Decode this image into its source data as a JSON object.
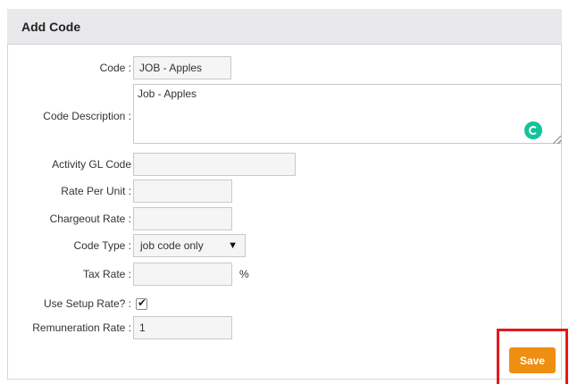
{
  "header": {
    "title": "Add Code"
  },
  "form": {
    "code": {
      "label": "Code :",
      "value": "JOB - Apples"
    },
    "description": {
      "label": "Code Description :",
      "value": "Job - Apples"
    },
    "activity_gl": {
      "label": "Activity GL Code",
      "value": ""
    },
    "rate_per_unit": {
      "label": "Rate Per Unit :",
      "value": ""
    },
    "chargeout_rate": {
      "label": "Chargeout Rate :",
      "value": ""
    },
    "code_type": {
      "label": "Code Type :",
      "value": "job code only",
      "arrow": "▼"
    },
    "tax_rate": {
      "label": "Tax Rate :",
      "value": "",
      "suffix": "%"
    },
    "use_setup_rate": {
      "label": "Use Setup Rate? :",
      "checked": true,
      "tick": "✔"
    },
    "remuneration_rate": {
      "label": "Remuneration Rate :",
      "value": "1"
    }
  },
  "actions": {
    "save_label": "Save"
  },
  "colors": {
    "accent": "#ee8f12",
    "highlight": "#e01b1b",
    "header_bg": "#e9e9ec"
  }
}
